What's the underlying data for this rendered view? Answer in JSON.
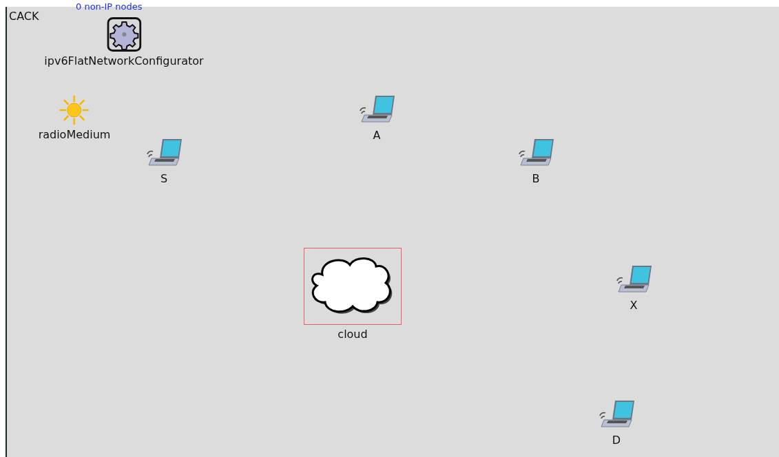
{
  "network": {
    "name": "CACK",
    "note": "0 non-IP nodes"
  },
  "nodes": [
    {
      "kind": "configurator",
      "name": "ipv6FlatNetworkConfigurator",
      "selected": false
    },
    {
      "kind": "medium",
      "name": "radioMedium",
      "selected": false
    },
    {
      "kind": "laptop",
      "name": "S",
      "selected": false
    },
    {
      "kind": "laptop",
      "name": "A",
      "selected": false
    },
    {
      "kind": "laptop",
      "name": "B",
      "selected": false
    },
    {
      "kind": "cloud",
      "name": "cloud",
      "selected": true
    },
    {
      "kind": "laptop",
      "name": "X",
      "selected": false
    },
    {
      "kind": "laptop",
      "name": "D",
      "selected": false
    }
  ]
}
